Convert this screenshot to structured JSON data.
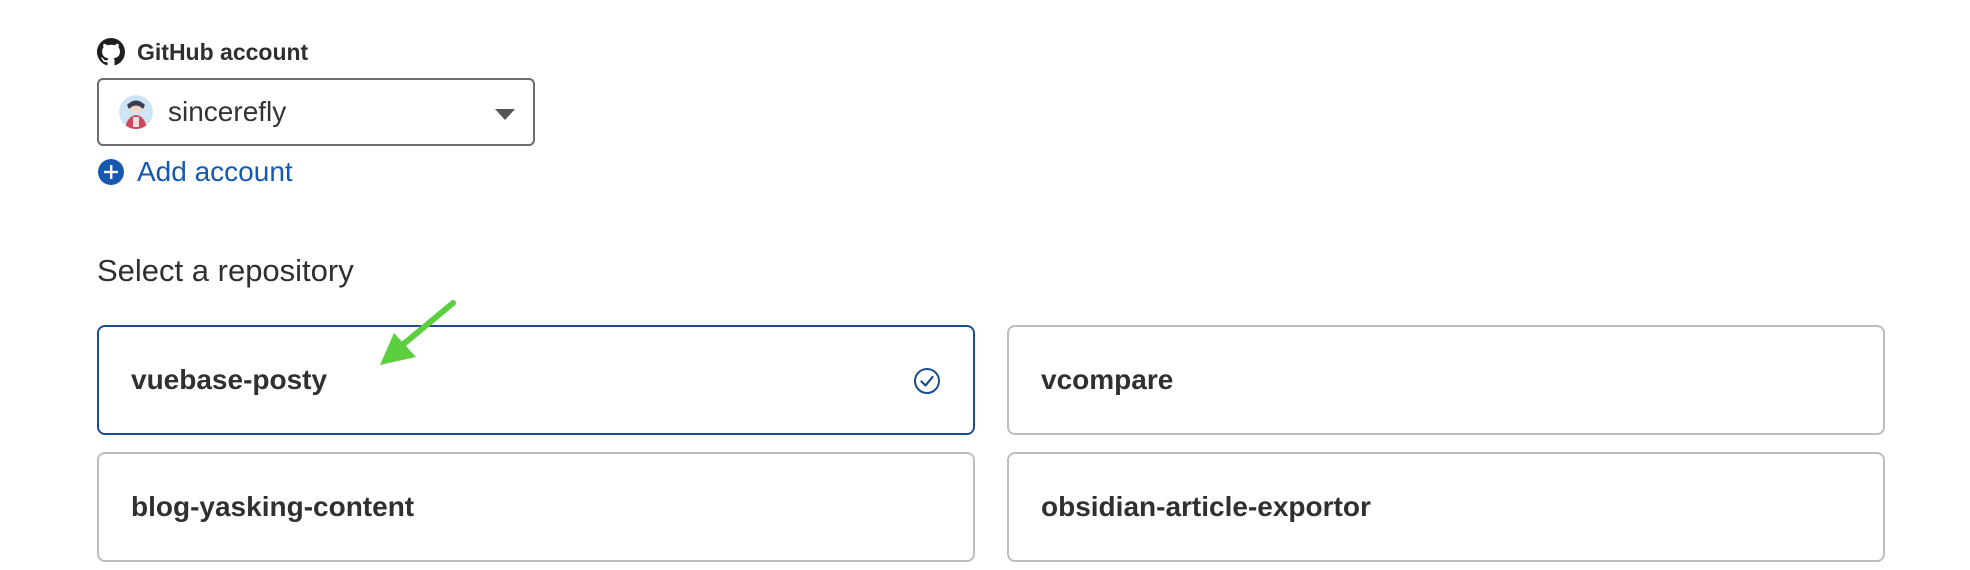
{
  "account": {
    "label": "GitHub account",
    "selected_value": "sincerefly",
    "add_label": "Add account"
  },
  "repositories": {
    "heading": "Select a repository",
    "items": [
      {
        "name": "vuebase-posty",
        "selected": true
      },
      {
        "name": "vcompare",
        "selected": false
      },
      {
        "name": "blog-yasking-content",
        "selected": false
      },
      {
        "name": "obsidian-article-exportor",
        "selected": false
      }
    ]
  },
  "icons": {
    "account_label_icon": "github-icon",
    "avatar": "avatar",
    "dropdown": "chevron-down-icon",
    "add": "plus-circle-icon",
    "selected": "check-circle-icon",
    "annotation": "green-arrow-icon"
  },
  "colors": {
    "link": "#1558b0",
    "selected_border": "#1a4f8f",
    "card_border": "#bdbdbd",
    "annotation_arrow": "#5ccf3f"
  }
}
